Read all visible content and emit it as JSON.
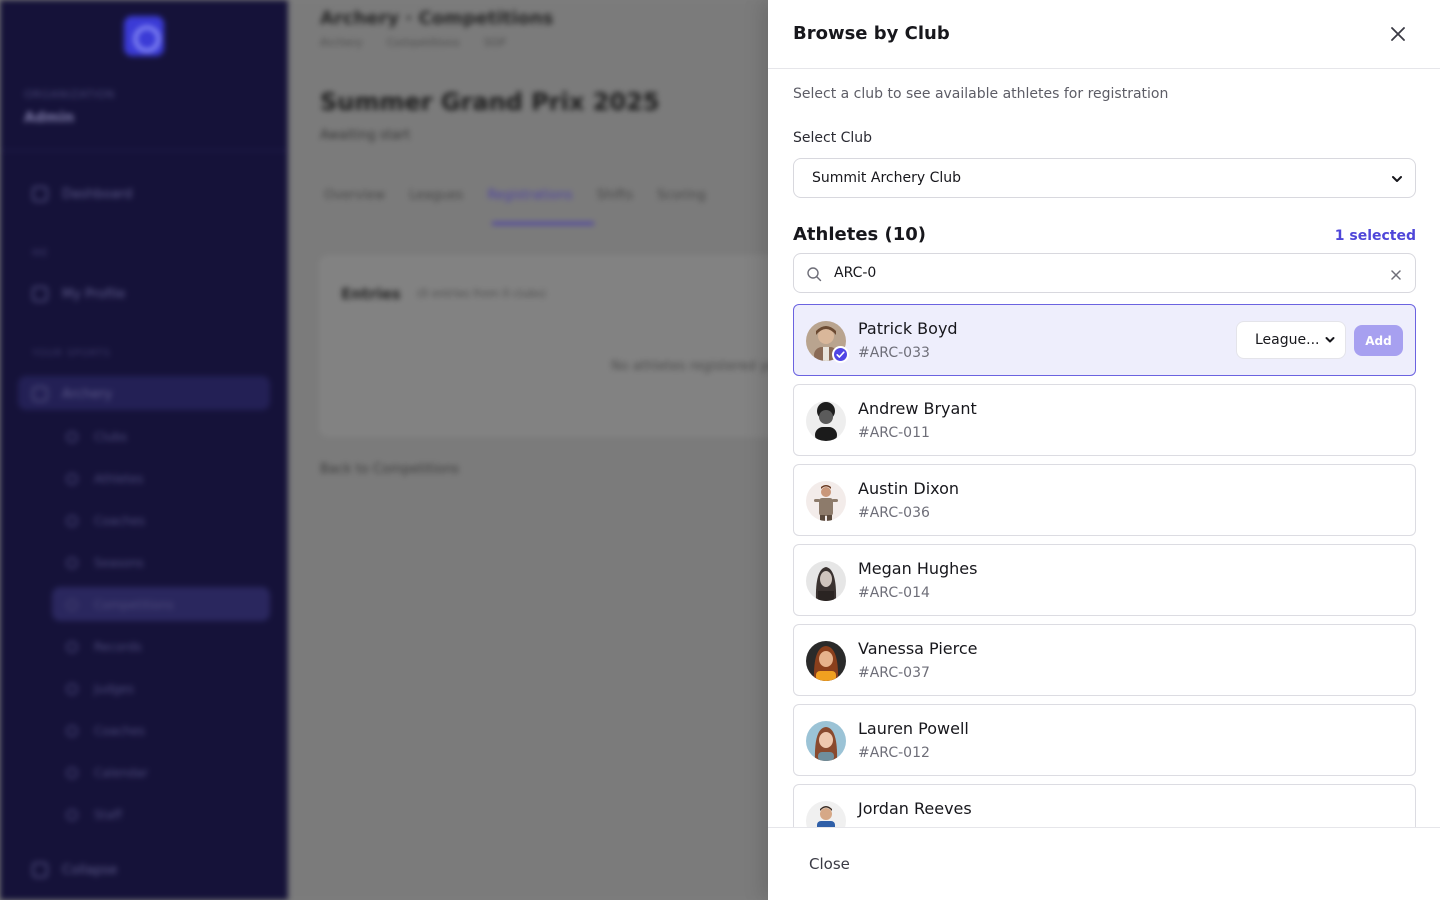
{
  "background": {
    "sidebar": {
      "org_label": "ORGANIZATION",
      "org_name": "Admin",
      "items": [
        {
          "label": "Dashboard"
        },
        {
          "label": "My Profile"
        },
        {
          "label": "Archery"
        }
      ],
      "sections": [
        "ME",
        "YOUR SPORTS"
      ],
      "sub_items": [
        {
          "label": "Clubs"
        },
        {
          "label": "Athletes"
        },
        {
          "label": "Coaches"
        },
        {
          "label": "Seasons"
        },
        {
          "label": "Competitions"
        },
        {
          "label": "Records"
        },
        {
          "label": "Judges"
        },
        {
          "label": "Coaches"
        },
        {
          "label": "Calendar"
        },
        {
          "label": "Staff"
        }
      ],
      "collapse": "Collapse"
    },
    "main": {
      "crumb_title": "Archery · Competitions",
      "crumbs": [
        "Archery",
        "Competitions",
        "SGP"
      ],
      "page_title": "Summer Grand Prix 2025",
      "status": "Awaiting start",
      "tabs": [
        "Overview",
        "Leagues",
        "Registrations",
        "Shifts",
        "Scoring"
      ],
      "card_title": "Entries",
      "card_sub": "(0 entries from 0 clubs)",
      "card_empty": "No athletes registered yet",
      "back_link": "Back to Competitions"
    }
  },
  "drawer": {
    "title": "Browse by Club",
    "subtitle": "Select a club to see available athletes for registration",
    "club_label": "Select Club",
    "club_value": "Summit Archery Club",
    "athletes_header": "Athletes (10)",
    "selected_count": "1 selected",
    "search_value": "ARC-0",
    "league_value": "League...",
    "add_label": "Add",
    "close_label": "Close",
    "athletes": [
      {
        "name": "Patrick Boyd",
        "code": "#ARC-033",
        "selected": true
      },
      {
        "name": "Andrew Bryant",
        "code": "#ARC-011"
      },
      {
        "name": "Austin Dixon",
        "code": "#ARC-036"
      },
      {
        "name": "Megan Hughes",
        "code": "#ARC-014"
      },
      {
        "name": "Vanessa Pierce",
        "code": "#ARC-037"
      },
      {
        "name": "Lauren Powell",
        "code": "#ARC-012"
      },
      {
        "name": "Jordan Reeves",
        "code": ""
      }
    ]
  },
  "colors": {
    "accent": "#4f46d9",
    "selected_bg": "#eeeefc",
    "sidebar_bg": "#151239"
  },
  "icons": [
    "close-icon",
    "search-icon",
    "chevron-down-icon",
    "check-icon"
  ]
}
